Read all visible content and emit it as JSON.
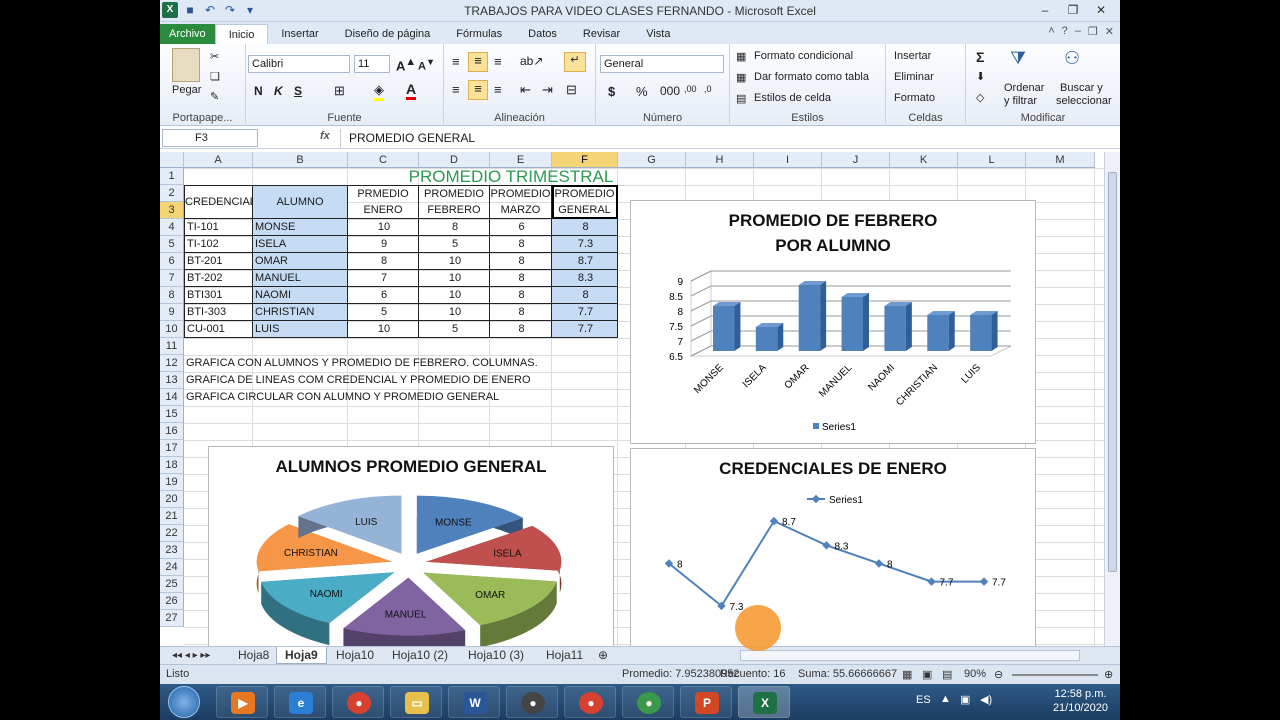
{
  "window": {
    "title": "TRABAJOS PARA VIDEO CLASES FERNANDO  -  Microsoft Excel"
  },
  "tabs": [
    "Archivo",
    "Inicio",
    "Insertar",
    "Diseño de página",
    "Fórmulas",
    "Datos",
    "Revisar",
    "Vista"
  ],
  "ribbon": {
    "clipboard": {
      "paste": "Pegar",
      "label": "Portapape..."
    },
    "font": {
      "name": "Calibri",
      "size": "11",
      "bold": "N",
      "italic": "K",
      "underline": "S",
      "label": "Fuente"
    },
    "alignment": {
      "label": "Alineación"
    },
    "number": {
      "format": "General",
      "currency": "$",
      "percent": "%",
      "label": "Número"
    },
    "styles": {
      "cond": "Formato condicional",
      "table": "Dar formato como tabla",
      "cell": "Estilos de celda",
      "label": "Estilos"
    },
    "cells": {
      "insert": "Insertar",
      "delete": "Eliminar",
      "format": "Formato",
      "label": "Celdas"
    },
    "edit": {
      "sum": "Σ",
      "sort1": "Ordenar",
      "sort2": "y filtrar",
      "find1": "Buscar y",
      "find2": "seleccionar",
      "label": "Modificar"
    }
  },
  "formula": {
    "cell": "F3",
    "fx": "fx",
    "value": "PROMEDIO GENERAL"
  },
  "columns": [
    "A",
    "B",
    "C",
    "D",
    "E",
    "F",
    "G",
    "H",
    "I",
    "J",
    "K",
    "L",
    "M"
  ],
  "rows": [
    "1",
    "2",
    "3",
    "4",
    "5",
    "6",
    "7",
    "8",
    "9",
    "10",
    "11",
    "12",
    "13",
    "14",
    "15",
    "16",
    "17",
    "18",
    "19",
    "20",
    "21",
    "22",
    "23",
    "24",
    "25",
    "26",
    "27"
  ],
  "sheet": {
    "title": "PROMEDIO TRIMESTRAL",
    "headers": {
      "a": "CREDENCIAL",
      "b": "ALUMNO",
      "c1": "PRMEDIO",
      "c2": "ENERO",
      "d1": "PROMEDIO",
      "d2": "FEBRERO",
      "e1": "PROMEDIO",
      "e2": "MARZO",
      "f1": "PROMEDIO",
      "f2": "GENERAL"
    },
    "data": [
      [
        "TI-101",
        "MONSE",
        "10",
        "8",
        "6",
        "8"
      ],
      [
        "TI-102",
        "ISELA",
        "9",
        "5",
        "8",
        "7.3"
      ],
      [
        "BT-201",
        "OMAR",
        "8",
        "10",
        "8",
        "8.7"
      ],
      [
        "BT-202",
        "MANUEL",
        "7",
        "10",
        "8",
        "8.3"
      ],
      [
        "BTI301",
        "NAOMI",
        "6",
        "10",
        "8",
        "8"
      ],
      [
        "BTI-303",
        "CHRISTIAN",
        "5",
        "10",
        "8",
        "7.7"
      ],
      [
        "CU-001",
        "LUIS",
        "10",
        "5",
        "8",
        "7.7"
      ]
    ],
    "notes": [
      "GRAFICA CON ALUMNOS Y PROMEDIO DE FEBRERO. COLUMNAS.",
      "GRAFICA DE LINEAS COM CREDENCIAL Y PROMEDIO DE ENERO",
      "GRAFICA CIRCULAR CON ALUMNO Y PROMEDIO GENERAL"
    ]
  },
  "chart_data": [
    {
      "type": "bar",
      "title": "PROMEDIO DE FEBRERO POR ALUMNO",
      "title1": "PROMEDIO DE FEBRERO",
      "title2": "POR ALUMNO",
      "categories": [
        "MONSE",
        "ISELA",
        "OMAR",
        "MANUEL",
        "NAOMI",
        "CHRISTIAN",
        "LUIS"
      ],
      "series": [
        {
          "name": "Series1",
          "values": [
            8.0,
            7.3,
            8.7,
            8.3,
            8.0,
            7.7,
            7.7
          ]
        }
      ],
      "ylim": [
        6.5,
        9
      ],
      "yticks": [
        "6.5",
        "7",
        "7.5",
        "8",
        "8.5",
        "9"
      ],
      "legend": "bottom",
      "color": "#4f81bd"
    },
    {
      "type": "line",
      "title": "CREDENCIALES DE ENERO",
      "series": [
        {
          "name": "Series1",
          "values": [
            8,
            7.3,
            8.7,
            8.3,
            8,
            7.7,
            7.7
          ]
        }
      ],
      "labels": [
        "8",
        "7.3",
        "8.7",
        "8.3",
        "8",
        "7.7",
        "7.7"
      ],
      "legend": "top",
      "color": "#4f81bd"
    },
    {
      "type": "pie",
      "title": "ALUMNOS PROMEDIO GENERAL",
      "categories": [
        "MONSE",
        "ISELA",
        "OMAR",
        "MANUEL",
        "NAOMI",
        "CHRISTIAN",
        "LUIS"
      ],
      "values": [
        8,
        7.3,
        8.7,
        8.3,
        8,
        7.7,
        7.7
      ],
      "colors": [
        "#4f81bd",
        "#c0504d",
        "#9bbb59",
        "#8064a2",
        "#4bacc6",
        "#f79646",
        "#95b3d7"
      ]
    }
  ],
  "sheets": [
    "Hoja8",
    "Hoja9",
    "Hoja10",
    "Hoja10 (2)",
    "Hoja10 (3)",
    "Hoja11"
  ],
  "status": {
    "ready": "Listo",
    "avg": "Promedio: 7.952380952",
    "count": "Recuento: 16",
    "sum": "Suma: 55.66666667",
    "zoom": "90%"
  },
  "taskbar": {
    "lang": "ES",
    "time": "12:58 p.m.",
    "date": "21/10/2020"
  }
}
